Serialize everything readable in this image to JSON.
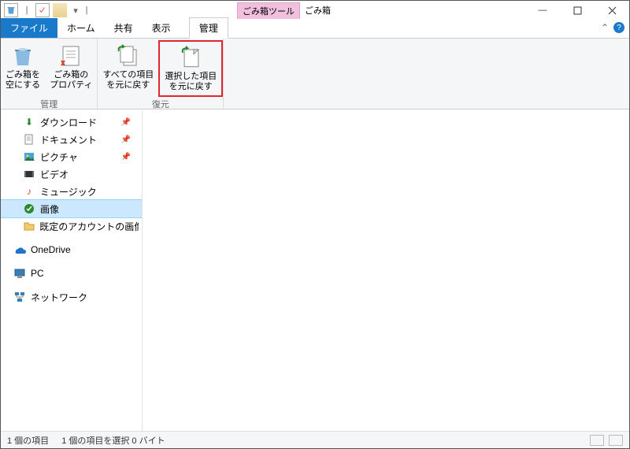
{
  "titlebar": {
    "tool_tab": "ごみ箱ツール",
    "title": "ごみ箱"
  },
  "tabs": {
    "file": "ファイル",
    "home": "ホーム",
    "share": "共有",
    "view": "表示",
    "context": "管理"
  },
  "ribbon": {
    "groups": {
      "manage": {
        "label": "管理",
        "empty": "ごみ箱を\n空にする",
        "properties": "ごみ箱の\nプロパティ"
      },
      "restore": {
        "label": "復元",
        "restore_all": "すべての項目\nを元に戻す",
        "restore_selected": "選択した項目\nを元に戻す"
      }
    }
  },
  "nav": {
    "downloads": "ダウンロード",
    "documents": "ドキュメント",
    "pictures": "ピクチャ",
    "videos": "ビデオ",
    "music": "ミュージック",
    "images": "画像",
    "account_images": "既定のアカウントの画像",
    "onedrive": "OneDrive",
    "pc": "PC",
    "network": "ネットワーク"
  },
  "status": {
    "count": "1 個の項目",
    "selected": "1 個の項目を選択 0 バイト"
  }
}
